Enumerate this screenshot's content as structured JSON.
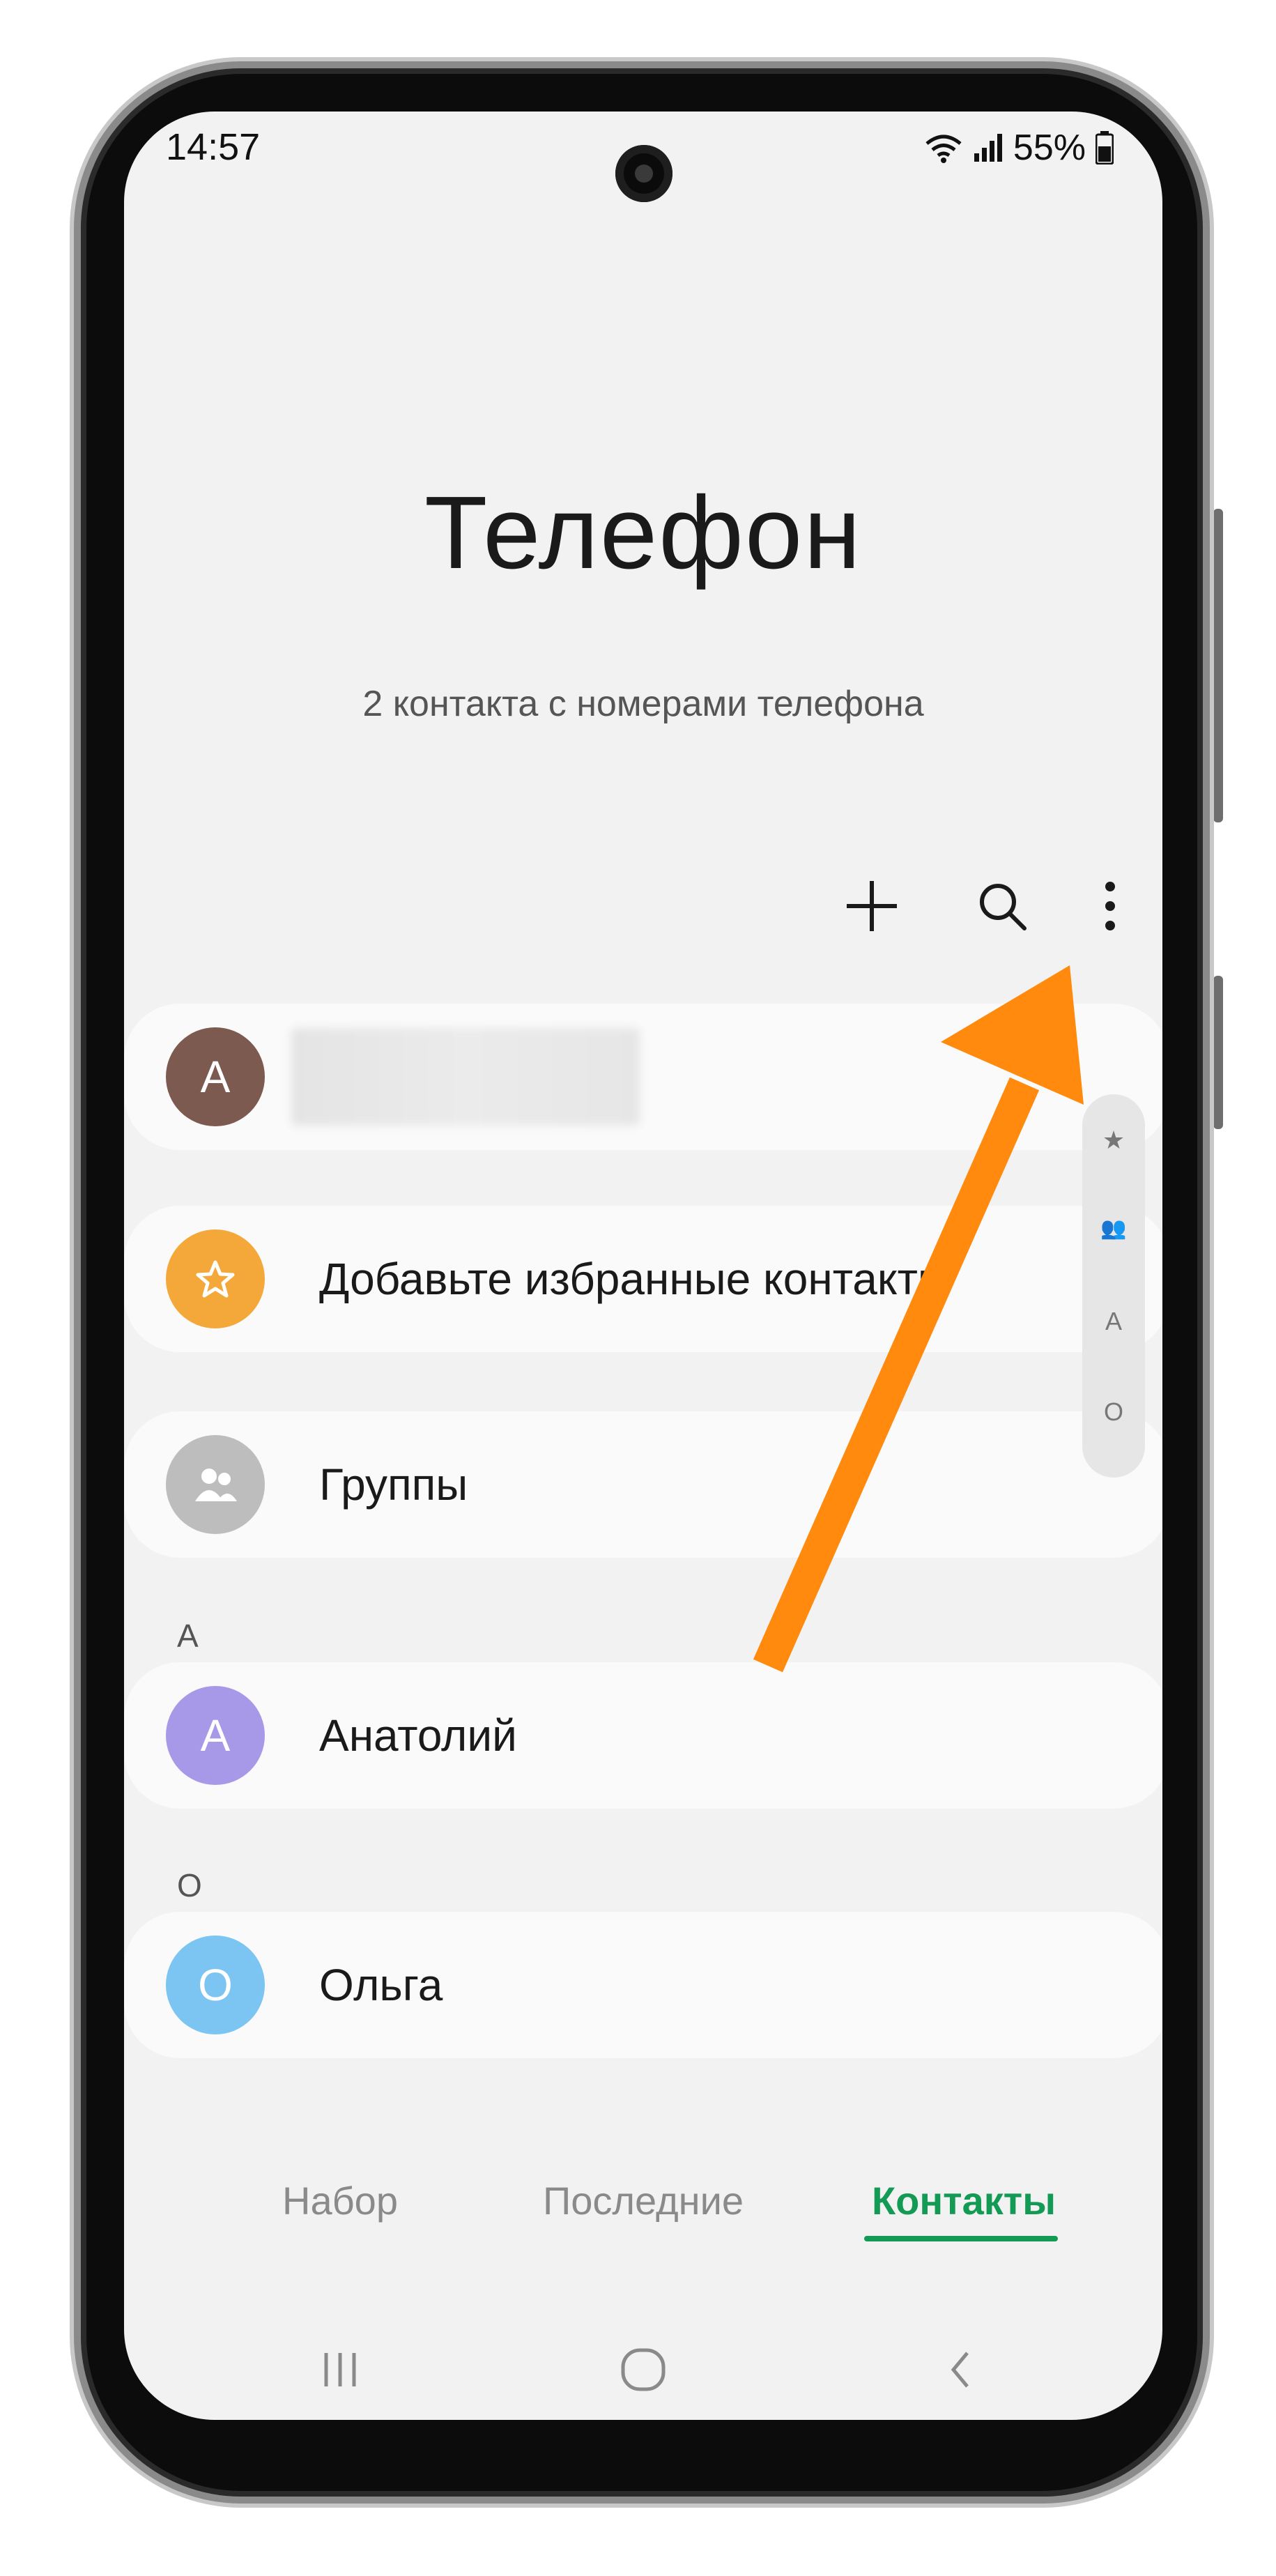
{
  "status_bar": {
    "time": "14:57",
    "battery": "55%"
  },
  "header": {
    "title": "Телефон",
    "subtitle": "2 контакта с номерами телефона"
  },
  "toolbar": {
    "icons": [
      "add-icon",
      "search-icon",
      "more-options-icon"
    ]
  },
  "profile": {
    "initial": "А",
    "name_hidden": true,
    "avatar_color": "#7d5a50"
  },
  "favorites": {
    "label": "Добавьте избранные контакты",
    "avatar_color": "#f5a83a"
  },
  "groups": {
    "label": "Группы",
    "avatar_color": "#bdbdbd"
  },
  "sections": [
    {
      "letter": "А",
      "contacts": [
        {
          "initial": "А",
          "name": "Анатолий",
          "avatar_color": "#a898e8"
        }
      ]
    },
    {
      "letter": "О",
      "contacts": [
        {
          "initial": "О",
          "name": "Ольга",
          "avatar_color": "#7cc4f2"
        }
      ]
    }
  ],
  "index_rail": [
    "★",
    "👥",
    "А",
    "О"
  ],
  "bottom_tabs": [
    {
      "label": "Набор",
      "active": false
    },
    {
      "label": "Последние",
      "active": false
    },
    {
      "label": "Контакты",
      "active": true
    }
  ],
  "colors": {
    "accent": "#139a54",
    "arrow": "#ff8a0d",
    "screen_bg": "#f2f2f2"
  }
}
